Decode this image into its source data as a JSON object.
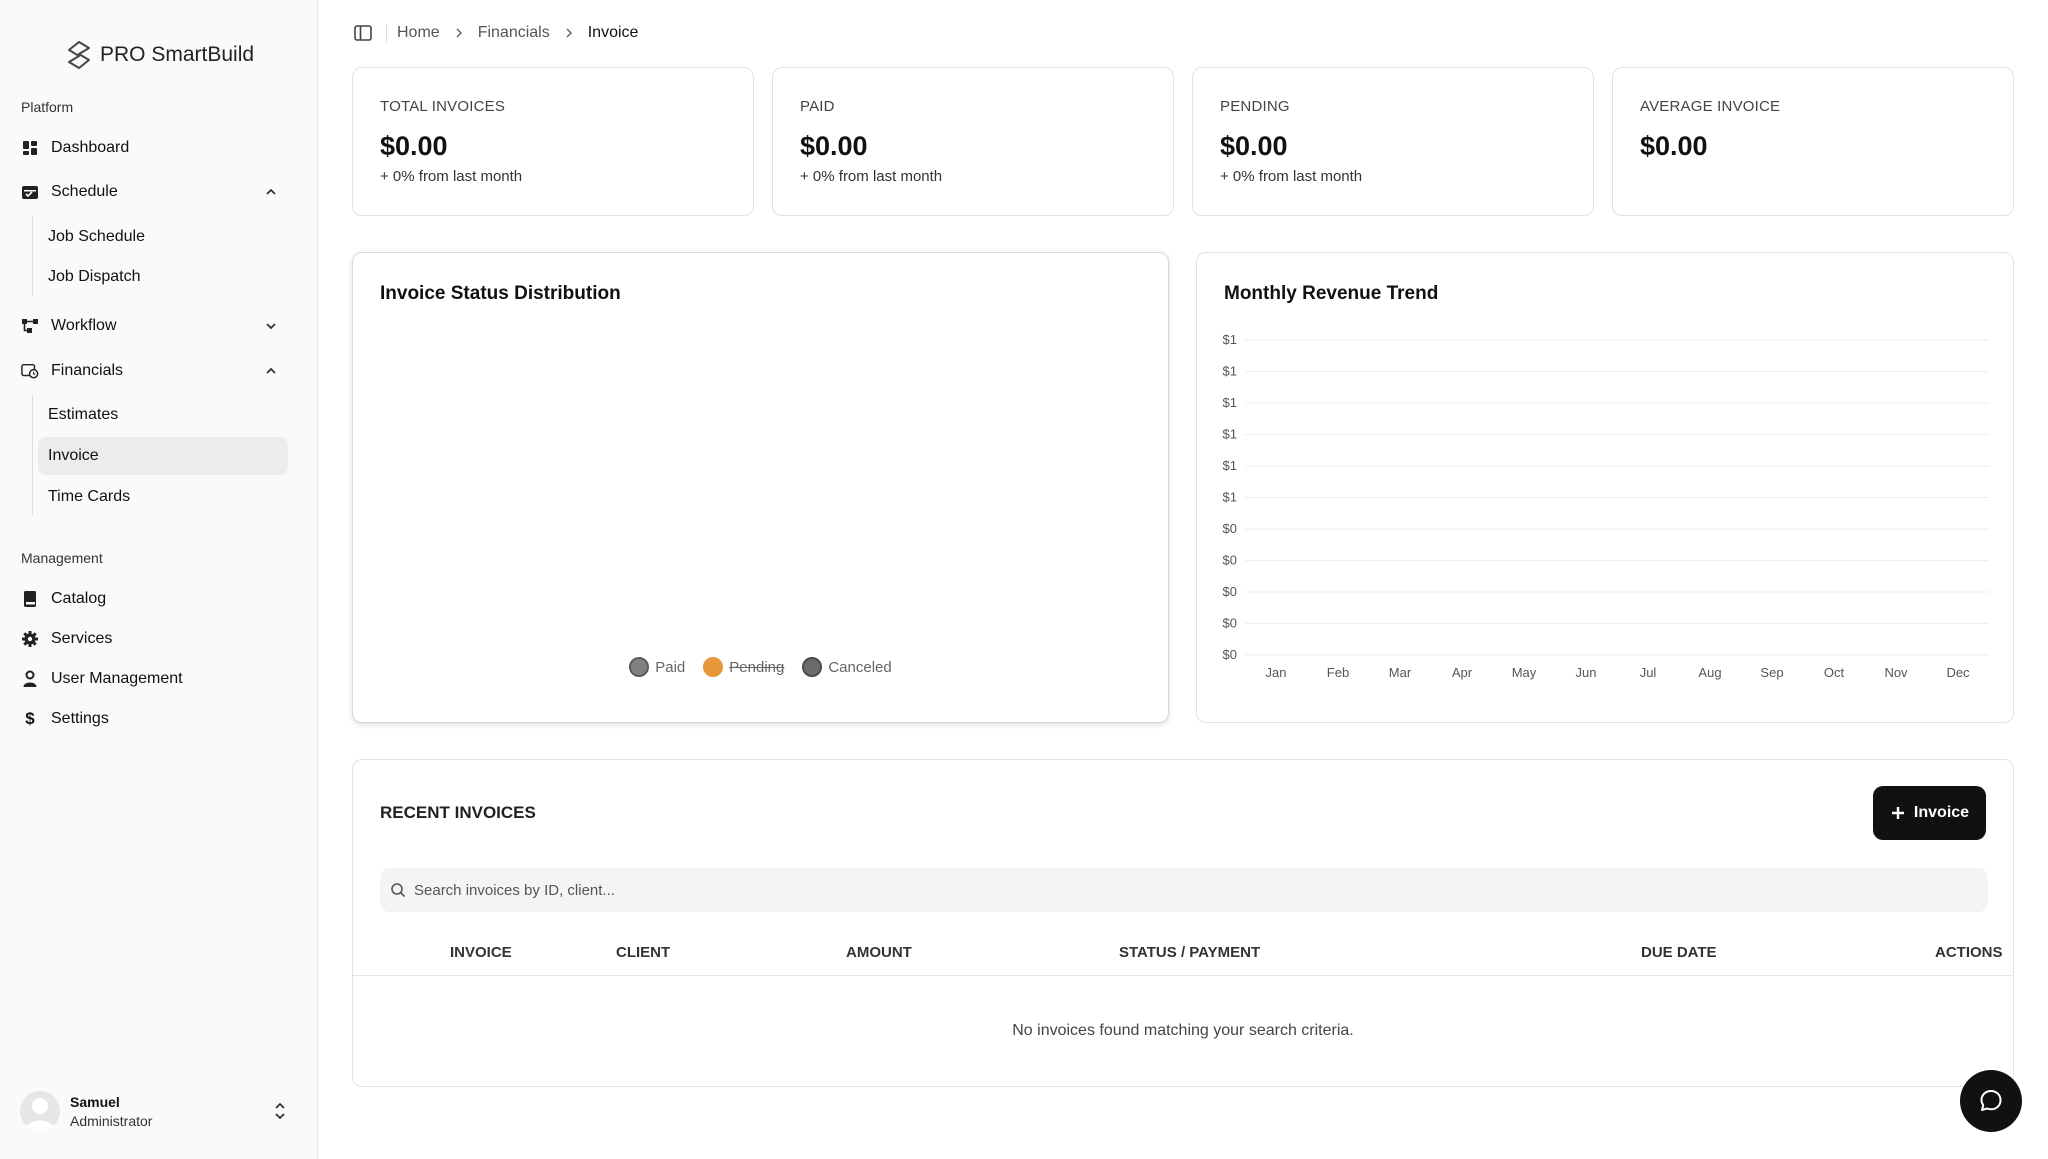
{
  "brand": {
    "name": "PRO SmartBuild"
  },
  "sidebar": {
    "platform_label": "Platform",
    "management_label": "Management",
    "items": {
      "dashboard": "Dashboard",
      "schedule": "Schedule",
      "job_schedule": "Job Schedule",
      "job_dispatch": "Job Dispatch",
      "workflow": "Workflow",
      "financials": "Financials",
      "estimates": "Estimates",
      "invoice": "Invoice",
      "time_cards": "Time Cards",
      "catalog": "Catalog",
      "services": "Services",
      "user_management": "User Management",
      "settings": "Settings"
    },
    "active_item": "Invoice"
  },
  "user": {
    "name": "Samuel",
    "role": "Administrator"
  },
  "breadcrumb": {
    "home": "Home",
    "section": "Financials",
    "current": "Invoice"
  },
  "stats": [
    {
      "title": "TOTAL INVOICES",
      "value": "$0.00",
      "sub": "+ 0% from last month"
    },
    {
      "title": "PAID",
      "value": "$0.00",
      "sub": "+ 0% from last month"
    },
    {
      "title": "PENDING",
      "value": "$0.00",
      "sub": "+ 0% from last month"
    },
    {
      "title": "AVERAGE INVOICE",
      "value": "$0.00"
    }
  ],
  "status_chart": {
    "title": "Invoice Status Distribution",
    "legend": [
      {
        "label": "Paid",
        "color": "#808080",
        "hidden": false
      },
      {
        "label": "Pending",
        "color": "#e5973a",
        "hidden": true
      },
      {
        "label": "Canceled",
        "color": "#6b6b6b",
        "hidden": false
      }
    ]
  },
  "chart_data": {
    "type": "line",
    "title": "Monthly Revenue Trend",
    "categories": [
      "Jan",
      "Feb",
      "Mar",
      "Apr",
      "May",
      "Jun",
      "Jul",
      "Aug",
      "Sep",
      "Oct",
      "Nov",
      "Dec"
    ],
    "values": [
      0,
      0,
      0,
      0,
      0,
      0,
      0,
      0,
      0,
      0,
      0,
      0
    ],
    "y_tick_labels": [
      "$1",
      "$1",
      "$1",
      "$1",
      "$1",
      "$1",
      "$0",
      "$0",
      "$0",
      "$0",
      "$0"
    ],
    "grid": true,
    "xlabel": "",
    "ylabel": ""
  },
  "recent": {
    "title": "RECENT INVOICES",
    "add_button_label": "Invoice",
    "search_placeholder": "Search invoices by ID, client...",
    "columns": [
      "INVOICE",
      "CLIENT",
      "AMOUNT",
      "STATUS / PAYMENT",
      "DUE DATE",
      "ACTIONS"
    ],
    "empty_message": "No invoices found matching your search criteria."
  },
  "colors": {
    "accent": "#111111",
    "pending": "#e5973a",
    "active_bg": "#ececec"
  }
}
